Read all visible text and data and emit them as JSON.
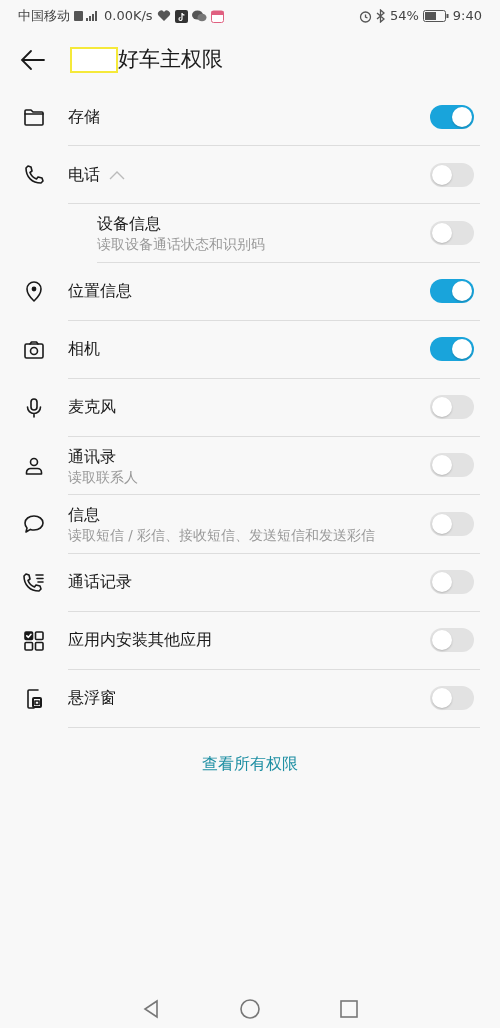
{
  "status_bar": {
    "carrier": "中国移动",
    "speed": "0.00K/s",
    "battery": "54%",
    "time": "9:40"
  },
  "header": {
    "title": "好车主权限",
    "redacted": true
  },
  "permissions": [
    {
      "title": "存储",
      "on": true
    },
    {
      "title": "电话",
      "on": false,
      "expanded": true,
      "children": [
        {
          "title": "设备信息",
          "subtitle": "读取设备通话状态和识别码",
          "on": false
        }
      ]
    },
    {
      "title": "位置信息",
      "on": true
    },
    {
      "title": "相机",
      "on": true
    },
    {
      "title": "麦克风",
      "on": false
    },
    {
      "title": "通讯录",
      "subtitle": "读取联系人",
      "on": false
    },
    {
      "title": "信息",
      "subtitle": "读取短信 / 彩信、接收短信、发送短信和发送彩信",
      "on": false
    },
    {
      "title": "通话记录",
      "on": false
    },
    {
      "title": "应用内安装其他应用",
      "on": false
    },
    {
      "title": "悬浮窗",
      "on": false
    }
  ],
  "footer_link": "查看所有权限"
}
